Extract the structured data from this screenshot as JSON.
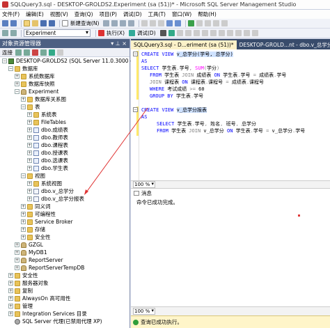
{
  "window": {
    "title": "SQLQuery3.sql - DESKTOP-GROLDS2.Experiment (sa (51))* - Microsoft SQL Server Management Studio"
  },
  "menu": {
    "items": [
      "文件(F)",
      "编辑(E)",
      "视图(V)",
      "查询(Q)",
      "项目(P)",
      "调试(D)",
      "工具(T)",
      "窗口(W)",
      "帮助(H)"
    ]
  },
  "toolbar": {
    "new_query": "新建查询(N)",
    "database": "Experiment",
    "execute": "执行(X)",
    "debug": "调试(D)"
  },
  "object_explorer": {
    "title": "对象资源管理器",
    "connect": "连接",
    "nodes": [
      {
        "label": "DESKTOP-GROLDS2 (SQL Server 11.0.3000 - sa",
        "icon": "server-icon",
        "exp": "-"
      },
      {
        "label": "数据库",
        "icon": "folder-icon",
        "exp": "-"
      },
      {
        "label": "系统数据库",
        "icon": "folder-icon",
        "exp": "+"
      },
      {
        "label": "数据库快照",
        "icon": "folder-icon",
        "exp": "+"
      },
      {
        "label": "Experiment",
        "icon": "database-icon",
        "exp": "-"
      },
      {
        "label": "数据库关系图",
        "icon": "folder-icon",
        "exp": "+"
      },
      {
        "label": "表",
        "icon": "folder-icon",
        "exp": "-"
      },
      {
        "label": "系统表",
        "icon": "folder-icon",
        "exp": "+"
      },
      {
        "label": "FileTables",
        "icon": "folder-icon",
        "exp": "+"
      },
      {
        "label": "dbo.成绩表",
        "icon": "table-icon",
        "exp": "+"
      },
      {
        "label": "dbo.教师表",
        "icon": "table-icon",
        "exp": "+"
      },
      {
        "label": "dbo.课程表",
        "icon": "table-icon",
        "exp": "+"
      },
      {
        "label": "dbo.授课表",
        "icon": "table-icon",
        "exp": "+"
      },
      {
        "label": "dbo.选课表",
        "icon": "table-icon",
        "exp": "+"
      },
      {
        "label": "dbo.学生表",
        "icon": "table-icon",
        "exp": "+"
      },
      {
        "label": "视图",
        "icon": "folder-icon",
        "exp": "-"
      },
      {
        "label": "系统视图",
        "icon": "folder-icon",
        "exp": "+"
      },
      {
        "label": "dbo.v_总学分",
        "icon": "view-icon",
        "exp": "+"
      },
      {
        "label": "dbo.v_总学分报表",
        "icon": "view-icon",
        "exp": "+"
      },
      {
        "label": "同义词",
        "icon": "folder-icon",
        "exp": "+"
      },
      {
        "label": "可编程性",
        "icon": "folder-icon",
        "exp": "+"
      },
      {
        "label": "Service Broker",
        "icon": "folder-icon",
        "exp": "+"
      },
      {
        "label": "存储",
        "icon": "folder-icon",
        "exp": "+"
      },
      {
        "label": "安全性",
        "icon": "folder-icon",
        "exp": "+"
      },
      {
        "label": "GZGL",
        "icon": "database-icon",
        "exp": "+"
      },
      {
        "label": "MyDB1",
        "icon": "database-icon",
        "exp": "+"
      },
      {
        "label": "ReportServer",
        "icon": "database-icon",
        "exp": "+"
      },
      {
        "label": "ReportServerTempDB",
        "icon": "database-icon",
        "exp": "+"
      },
      {
        "label": "安全性",
        "icon": "folder-icon",
        "exp": "+"
      },
      {
        "label": "服务器对象",
        "icon": "folder-icon",
        "exp": "+"
      },
      {
        "label": "复制",
        "icon": "folder-icon",
        "exp": "+"
      },
      {
        "label": "AlwaysOn 高可用性",
        "icon": "folder-icon",
        "exp": "+"
      },
      {
        "label": "管理",
        "icon": "folder-icon",
        "exp": "+"
      },
      {
        "label": "Integration Services 目录",
        "icon": "folder-icon",
        "exp": "+"
      },
      {
        "label": "SQL Server 代理(已禁用代理 XP)",
        "icon": "agent-icon",
        "exp": ""
      }
    ]
  },
  "tabs": [
    {
      "label": "SQLQuery3.sql - D...eriment (sa (51))*",
      "active": true
    },
    {
      "label": "DESKTOP-GROLD...nt - dbo.v_总学分*",
      "active": false
    }
  ],
  "editor": {
    "lines": [
      "CREATE VIEW v_总学分(学号, 总学分)",
      "AS",
      "SELECT 学生表.学号, SUM(学分)",
      "FROM 学生表 JOIN 成绩表 ON 学生表.学号 = 成绩表.学号",
      "JOIN 课程表 ON 课程表.课程号 = 成绩表.课程号",
      "WHERE 考试成绩 >= 60",
      "GROUP BY 学生表.学号",
      "",
      "CREATE VIEW v_总学分报表",
      "AS",
      "SELECT 学生表.学号, 姓名, 班号, 总学分",
      "FROM 学生表 JOIN v_总学分 ON 学生表.学号 = v_总学分.学号"
    ]
  },
  "zoom": {
    "editor": "100 %",
    "results": "100 %"
  },
  "results": {
    "tab_label": "消息",
    "message": "命令已成功完成。"
  },
  "status": {
    "text": "查询已成功执行。",
    "success_color": "#2f9e3a"
  }
}
